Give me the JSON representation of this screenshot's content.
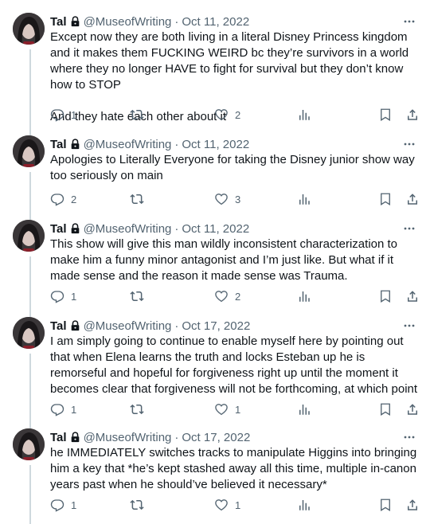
{
  "tweets": [
    {
      "name": "Tal",
      "handle": "@MuseofWriting",
      "separator": "·",
      "date": "Oct 11, 2022",
      "text": "Except now they are both living in a literal Disney Princess kingdom and it makes them FUCKING WEIRD bc they’re survivors in a world where they no longer HAVE to fight for survival but they don’t know how to STOP\n\nAnd they hate each other about it",
      "replies": "1",
      "retweets": "",
      "likes": "2"
    },
    {
      "name": "Tal",
      "handle": "@MuseofWriting",
      "separator": "·",
      "date": "Oct 11, 2022",
      "text": "Apologies to Literally Everyone for taking the Disney junior show way too seriously on main",
      "replies": "2",
      "retweets": "",
      "likes": "3"
    },
    {
      "name": "Tal",
      "handle": "@MuseofWriting",
      "separator": "·",
      "date": "Oct 11, 2022",
      "text": "This show will give this man wildly inconsistent characterization to make him a funny minor antagonist and I’m just like. But what if it made sense and the reason it made sense was Trauma.",
      "replies": "1",
      "retweets": "",
      "likes": "2"
    },
    {
      "name": "Tal",
      "handle": "@MuseofWriting",
      "separator": "·",
      "date": "Oct 17, 2022",
      "text": "I am simply going to continue to enable myself here by pointing out that when Elena learns the truth and locks Esteban up he is remorseful and hopeful for forgiveness right up until the moment it becomes clear that forgiveness will not be forthcoming, at which point",
      "replies": "1",
      "retweets": "",
      "likes": "1"
    },
    {
      "name": "Tal",
      "handle": "@MuseofWriting",
      "separator": "·",
      "date": "Oct 17, 2022",
      "text": "he IMMEDIATELY switches tracks to manipulate Higgins into bringing him a key that *he’s kept stashed away all this time, multiple in-canon years past when he should’ve believed it necessary*",
      "replies": "1",
      "retweets": "",
      "likes": "1"
    }
  ],
  "icons": {
    "lock": "lock-icon",
    "more": "more-icon",
    "reply": "reply-icon",
    "retweet": "retweet-icon",
    "like": "heart-icon",
    "views": "views-icon",
    "bookmark": "bookmark-icon",
    "share": "share-icon"
  },
  "colors": {
    "text": "#0f1419",
    "secondary": "#536471",
    "thread_line": "#cfd9de"
  }
}
